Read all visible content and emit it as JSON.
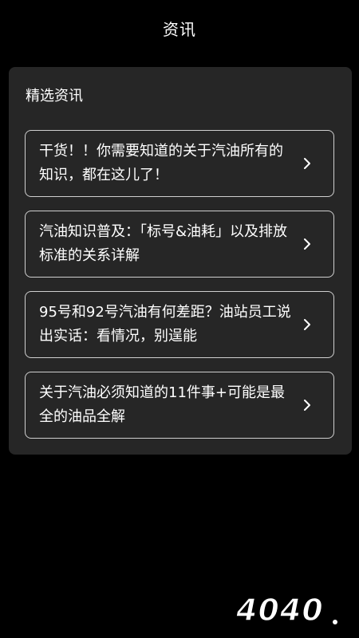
{
  "header": {
    "title": "资讯"
  },
  "section": {
    "title": "精选资讯"
  },
  "articles": [
    {
      "title": "干货！！你需要知道的关于汽油所有的知识，都在这儿了！"
    },
    {
      "title": "汽油知识普及：「标号&油耗」以及排放标准的关系详解"
    },
    {
      "title": "95号和92号汽油有何差距？油站员工说出实话：看情况，别逞能"
    },
    {
      "title": "关于汽油必须知道的11件事+可能是最全的油品全解"
    }
  ],
  "icons": {
    "item_chevron": "chevron-right-icon",
    "watermark": "4040-logo-watermark"
  },
  "watermark": {
    "text": "4040"
  },
  "colors": {
    "background": "#000000",
    "panel": "#262626",
    "card_border": "#cfcfcf",
    "text": "#ffffff"
  }
}
